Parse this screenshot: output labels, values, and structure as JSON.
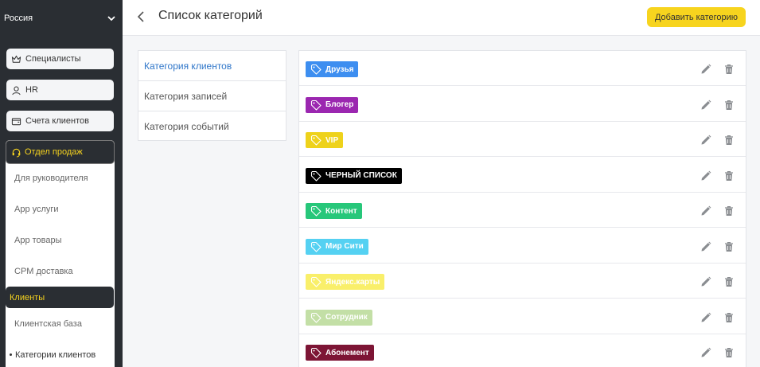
{
  "sidebar": {
    "region": "Россия",
    "buttons": {
      "specialists": "Специалисты",
      "hr": "HR",
      "accounts": "Счета клиентов"
    },
    "sales": {
      "title": "Отдел продаж",
      "items": [
        "Для руководителя",
        "App услуги",
        "App товары",
        "CPM доставка"
      ],
      "clients_title": "Клиенты",
      "client_items": [
        "Клиентская база",
        "Категории клиентов"
      ]
    }
  },
  "header": {
    "title": "Список категорий",
    "add_button": "Добавить категорию"
  },
  "category_types": [
    "Категория клиентов",
    "Категория записей",
    "Категория событий"
  ],
  "categories": [
    {
      "name": "Друзья",
      "color": "#3d8ef0",
      "text_color": "#ffffff"
    },
    {
      "name": "Блогер",
      "color": "#9b27b0",
      "text_color": "#ffffff"
    },
    {
      "name": "VIP",
      "color": "#eed21b",
      "text_color": "#ffffff"
    },
    {
      "name": "ЧЕРНЫЙ СПИСОК",
      "color": "#000000",
      "text_color": "#ffffff"
    },
    {
      "name": "Контент",
      "color": "#27c77a",
      "text_color": "#ffffff"
    },
    {
      "name": "Мир Сити",
      "color": "#55d1f2",
      "text_color": "#ffffff"
    },
    {
      "name": "Яндекс.карты",
      "color": "#f9ef6a",
      "text_color": "#ffffff"
    },
    {
      "name": "Сотрудник",
      "color": "#c3dfa6",
      "text_color": "#ffffff"
    },
    {
      "name": "Абонемент",
      "color": "#7d1535",
      "text_color": "#ffffff"
    }
  ]
}
